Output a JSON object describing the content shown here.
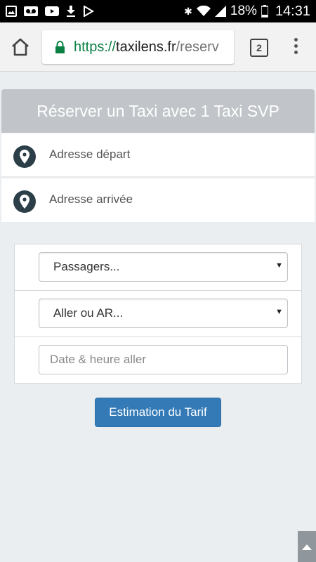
{
  "status_bar": {
    "battery": "18%",
    "time": "14:31"
  },
  "browser": {
    "url_scheme": "https://",
    "url_host": "taxilens.fr",
    "url_path": "/reserv",
    "tab_count": "2"
  },
  "booking": {
    "title": "Réserver un Taxi avec 1 Taxi SVP",
    "departure_placeholder": "Adresse départ",
    "arrival_placeholder": "Adresse arrivée",
    "passengers_selected": "Passagers...",
    "trip_type_selected": "Aller ou AR...",
    "datetime_placeholder": "Date & heure aller",
    "submit_label": "Estimation du Tarif"
  }
}
